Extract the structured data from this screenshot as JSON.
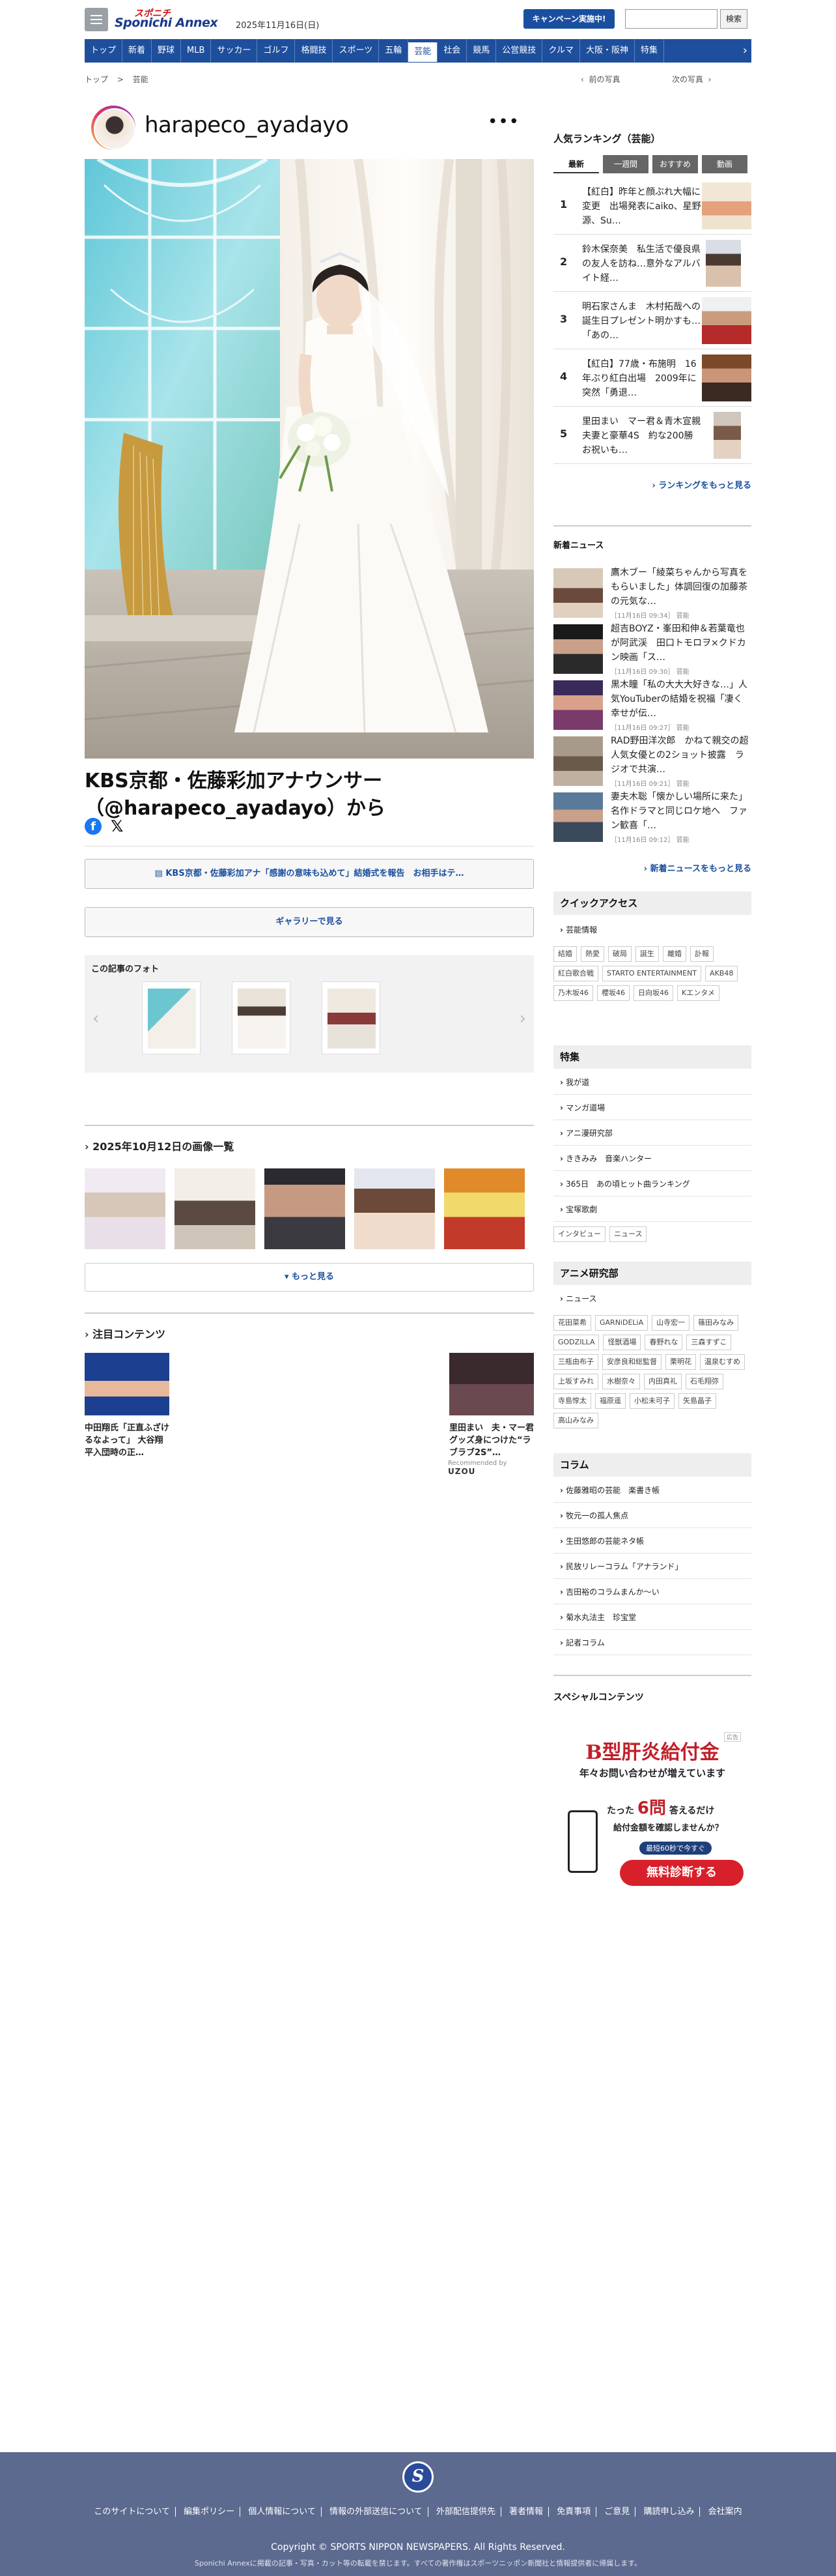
{
  "header": {
    "logo_top": "スポニチ",
    "logo_bottom": "Sponichi Annex",
    "date": "2025年11月16日(日)",
    "campaign_label": "キャンペーン実施中!",
    "search_placeholder": "",
    "search_button": "検索"
  },
  "nav": {
    "items": [
      "トップ",
      "新着",
      "野球",
      "MLB",
      "サッカー",
      "ゴルフ",
      "格闘技",
      "スポーツ",
      "五輪",
      "芸能",
      "社会",
      "競馬",
      "公営競技",
      "クルマ",
      "大阪・阪神",
      "特集"
    ],
    "active_index": 9,
    "more_icon": "chevron-right"
  },
  "breadcrumb": {
    "home": "トップ",
    "separator": ">",
    "current": "芸能"
  },
  "pager": {
    "prev": "前の写真",
    "next": "次の写真"
  },
  "post": {
    "username": "harapeco_ayadayo",
    "caption": "KBS京都・佐藤彩加アナウンサー（@harapeco_ayadayo）から",
    "article_link": "KBS京都・佐藤彩加アナ「感謝の意味も込めて」結婚式を報告　お相手はテ…",
    "gallery_button": "ギャラリーで見る"
  },
  "related": {
    "title": "この記事のフォト",
    "count": 3
  },
  "date_images": {
    "title": "2025年10月12日の画像一覧",
    "more": "もっと見る",
    "count": 5
  },
  "attention": {
    "title": "注目コンテンツ",
    "cards": [
      {
        "text": "中田翔氏「正直ふざけるなよって」 大谷翔平入団時の正…"
      },
      {
        "text": "里田まい　夫・マー君グッズ身につけた“ラブラブ2S”…"
      }
    ],
    "recommended_by": "Recommended by",
    "recommended_brand": "UZOU"
  },
  "ranking": {
    "title": "人気ランキング（芸能）",
    "tabs": [
      "最新",
      "一週間",
      "おすすめ",
      "動画"
    ],
    "active_tab": 0,
    "items": [
      {
        "rank": "1",
        "text": "【紅白】昨年と顔ぶれ大幅に変更　出場発表にaiko、星野源、Su…"
      },
      {
        "rank": "2",
        "text": "鈴木保奈美　私生活で優良県の友人を訪ね…意外なアルバイト経…"
      },
      {
        "rank": "3",
        "text": "明石家さんま　木村拓哉への誕生日プレゼント明かすも…「あの…"
      },
      {
        "rank": "4",
        "text": "【紅白】77歳・布施明　16年ぶり紅白出場　2009年に突然「勇退…"
      },
      {
        "rank": "5",
        "text": "里田まい　マー君＆青木宣親夫妻と豪華4S　約な200勝お祝いも…"
      }
    ],
    "more": "ランキングをもっと見る"
  },
  "latest": {
    "title": "新着ニュース",
    "items": [
      {
        "text": "鷹木ブー「綾菜ちゃんから写真をもらいました」体調回復の加藤茶の元気な…",
        "time": "［11月16日 09:34］",
        "cat": "芸能"
      },
      {
        "text": "超吉BOYZ・峯田和伸＆若葉竜也が阿武渓　田口トモロヲ×クドカン映画「ス…",
        "time": "［11月16日 09:30］",
        "cat": "芸能"
      },
      {
        "text": "黒木瞳「私の大大大好きな…」人気YouTuberの結婚を祝福「凄く幸せが伝…",
        "time": "［11月16日 09:27］",
        "cat": "芸能"
      },
      {
        "text": "RAD野田洋次郎　かねて親交の超人気女優との2ショット披露　ラジオで共演…",
        "time": "［11月16日 09:21］",
        "cat": "芸能"
      },
      {
        "text": "妻夫木聡「懐かしい場所に来た」名作ドラマと同じロケ地へ　ファン歓喜「…",
        "time": "［11月16日 09:12］",
        "cat": "芸能"
      }
    ],
    "more": "新着ニュースをもっと見る"
  },
  "quick": {
    "title": "クイックアクセス",
    "link": "芸能情報",
    "tags": [
      "結婚",
      "熱愛",
      "破局",
      "誕生",
      "離婚",
      "訃報",
      "紅白歌合戦",
      "STARTO ENTERTAINMENT",
      "AKB48",
      "乃木坂46",
      "櫻坂46",
      "日向坂46",
      "Kエンタメ"
    ]
  },
  "special": {
    "title": "特集",
    "links": [
      "我が道",
      "マンガ道場",
      "アニ漫研究部",
      "ききみみ　音楽ハンター",
      "365日　あの頃ヒット曲ランキング",
      "宝塚歌劇"
    ],
    "tags": [
      "インタビュー",
      "ニュース"
    ]
  },
  "anime": {
    "title": "アニメ研究部",
    "link": "ニュース",
    "tags": [
      "花田菜希",
      "GARNiDELiA",
      "山寺宏一",
      "篠田みなみ",
      "GODZILLA",
      "怪獣酒場",
      "春野れな",
      "三森すずこ",
      "三瓶由布子",
      "安彦良和総監督",
      "栗明花",
      "温泉むすめ",
      "上坂すみれ",
      "水樹奈々",
      "内田真礼",
      "石毛翔弥",
      "寺島惇太",
      "福原遥",
      "小松未可子",
      "矢島晶子",
      "高山みなみ"
    ]
  },
  "column": {
    "title": "コラム",
    "links": [
      "佐藤雅昭の芸能　楽書き帳",
      "牧元一の孤人焦点",
      "生田悠郎の芸能ネタ帳",
      "民放リレーコラム「アナランド」",
      "吉田裕のコラムまんか〜い",
      "菊水丸法主　珍宝堂",
      "記者コラム"
    ]
  },
  "special_content": {
    "title": "スペシャルコンテンツ"
  },
  "ad": {
    "badge": "広告",
    "headline": "B型肝炎給付金",
    "sub": "年々お問い合わせが増えています",
    "line1": "たった",
    "num": "6問",
    "line1b": "答えるだけ",
    "line2": "給付金額を確認しませんか？",
    "pill": "最短60秒で今すぐ",
    "cta": "無料診断する"
  },
  "footer": {
    "logo_glyph": "S",
    "links": [
      "このサイトについて",
      "編集ポリシー",
      "個人情報について",
      "情報の外部送信について",
      "外部配信提供先",
      "著者情報",
      "免責事項",
      "ご意見",
      "購読申し込み",
      "会社案内"
    ],
    "copyright": "Copyright © SPORTS NIPPON NEWSPAPERS. All Rights Reserved.",
    "note": "Sponichi Annexに掲載の記事・写真・カット等の転載を禁じます。すべての著作権はスポーツニッポン新聞社と情報提供者に帰属します。"
  },
  "colors": {
    "brand": "#1e4f9c",
    "accent_red": "#d01010",
    "footer": "#5d6a8f"
  }
}
